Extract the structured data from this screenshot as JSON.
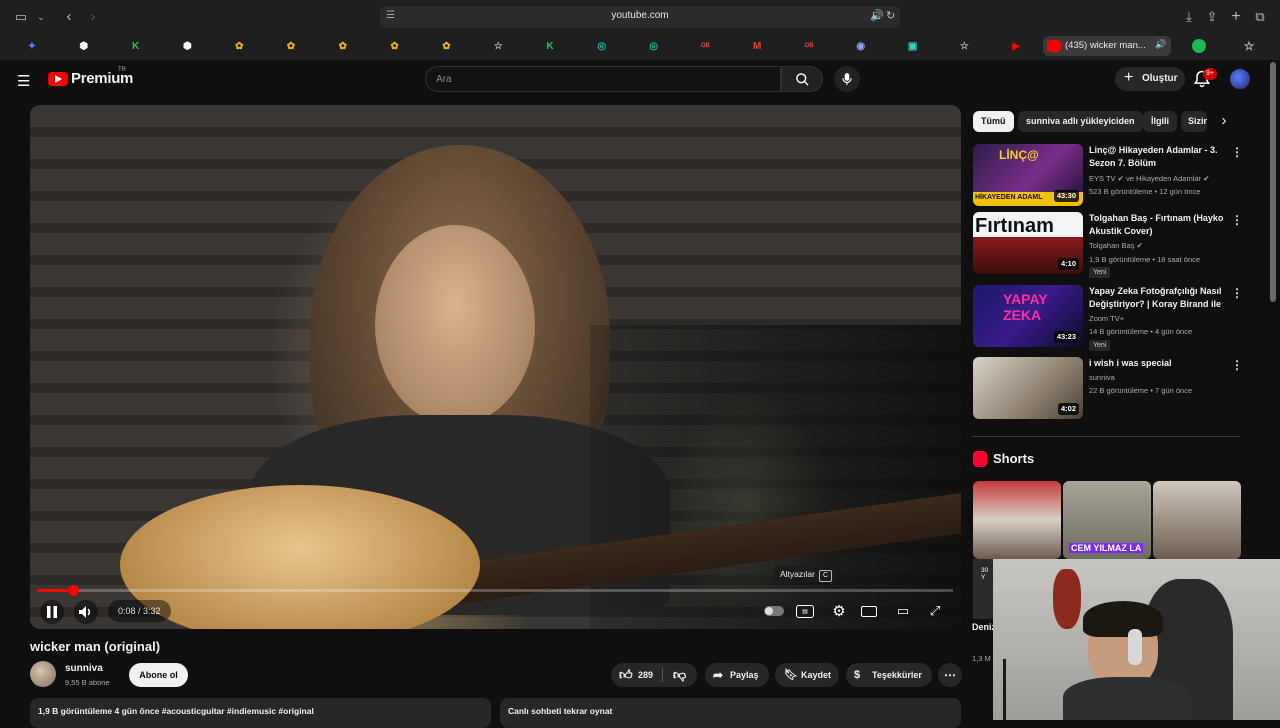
{
  "browser": {
    "url": "youtube.com",
    "active_tab_label": "(435) wicker man...",
    "tabs": [
      {
        "icon": "sparkle-icon",
        "color": "#4a8cff"
      },
      {
        "icon": "shield-icon",
        "color": "#ffffff"
      },
      {
        "icon": "k-icon",
        "color": "#22c55e"
      },
      {
        "icon": "shield-icon",
        "color": "#ffffff"
      },
      {
        "icon": "bee-icon",
        "color": "#f2b01e"
      },
      {
        "icon": "bee-icon",
        "color": "#f2b01e"
      },
      {
        "icon": "bee-icon",
        "color": "#f2b01e"
      },
      {
        "icon": "bee-icon",
        "color": "#f2b01e"
      },
      {
        "icon": "bee-icon",
        "color": "#f2b01e"
      },
      {
        "icon": "star-icon",
        "color": "#bbbbbb"
      },
      {
        "icon": "k-icon",
        "color": "#22c55e"
      },
      {
        "icon": "chatgpt-icon",
        "color": "#14b8a6"
      },
      {
        "icon": "chatgpt-icon",
        "color": "#14b8a6"
      },
      {
        "icon": "ob-icon",
        "color": "#ef4444"
      },
      {
        "icon": "gmail-icon",
        "color": "#ea4335"
      },
      {
        "icon": "ob-icon",
        "color": "#ef4444"
      },
      {
        "icon": "discord-icon",
        "color": "#8ea1ff"
      },
      {
        "icon": "app-icon",
        "color": "#2dd4bf"
      },
      {
        "icon": "star-icon",
        "color": "#bbbbbb"
      },
      {
        "icon": "youtube-icon",
        "color": "#ff0000"
      }
    ]
  },
  "header": {
    "logo_text": "Premium",
    "region": "TR",
    "search_placeholder": "Ara",
    "create_label": "Oluştur",
    "notifications": "9+"
  },
  "player": {
    "current_time": "0:08",
    "duration": "3:32",
    "progress": 0.038,
    "tooltip_label": "Altyazılar",
    "tooltip_key": "C"
  },
  "video": {
    "title": "wicker man (original)",
    "channel": "sunniva",
    "subscribers": "9,55 B abone",
    "subscribe_label": "Abone ol",
    "likes": "289",
    "share_label": "Paylaş",
    "save_label": "Kaydet",
    "thanks_label": "Teşekkürler",
    "description": "1,9 B görüntüleme  4 gün önce  #acousticguitar #indiemusic #original",
    "chat_replay": "Canlı sohbeti tekrar oynat"
  },
  "sidebar": {
    "chips": [
      "Tümü",
      "sunniva adlı yükleyiciden",
      "İlgili",
      "Sizin için"
    ],
    "recommendations": [
      {
        "title": "Linç@ Hikayeden Adamlar - 3. Sezon 7. Bölüm",
        "channel": "EYS TV ✔ ve Hikayeden Adamlar ✔",
        "meta": "523 B görüntüleme • 12 gün önce",
        "duration": "43:30",
        "badge": ""
      },
      {
        "title": "Tolgahan Baş - Fırtınam (Hayko Akustik Cover)",
        "channel": "Tolgahan Baş ✔",
        "meta": "1,9 B görüntüleme • 18 saat önce",
        "duration": "4:10",
        "badge": "Yeni"
      },
      {
        "title": "Yapay Zeka Fotoğrafçılığı Nasıl Değiştiriyor? | Koray Birand ile ...",
        "channel": "Zoom TV+",
        "meta": "14 B görüntüleme • 4 gün önce",
        "duration": "43:23",
        "badge": "Yeni"
      },
      {
        "title": "i wish i was special",
        "channel": "sunniva",
        "meta": "22 B görüntüleme • 7 gün önce",
        "duration": "4:02",
        "badge": ""
      }
    ],
    "shorts_label": "Shorts",
    "shorts": [
      {
        "caption": ""
      },
      {
        "caption": "CEM YILMAZ LA"
      },
      {
        "caption": ""
      }
    ],
    "short_left_title": "Deniz Bays",
    "short_left_views": "1,3 M görün",
    "short_left_badge": "30 Y"
  },
  "thumb_text": {
    "t1": "LİNÇ@",
    "t1b": "HİKAYEDEN ADAML",
    "t2": "Fırtınam",
    "t3a": "YAPAY",
    "t3b": "ZEKA"
  }
}
